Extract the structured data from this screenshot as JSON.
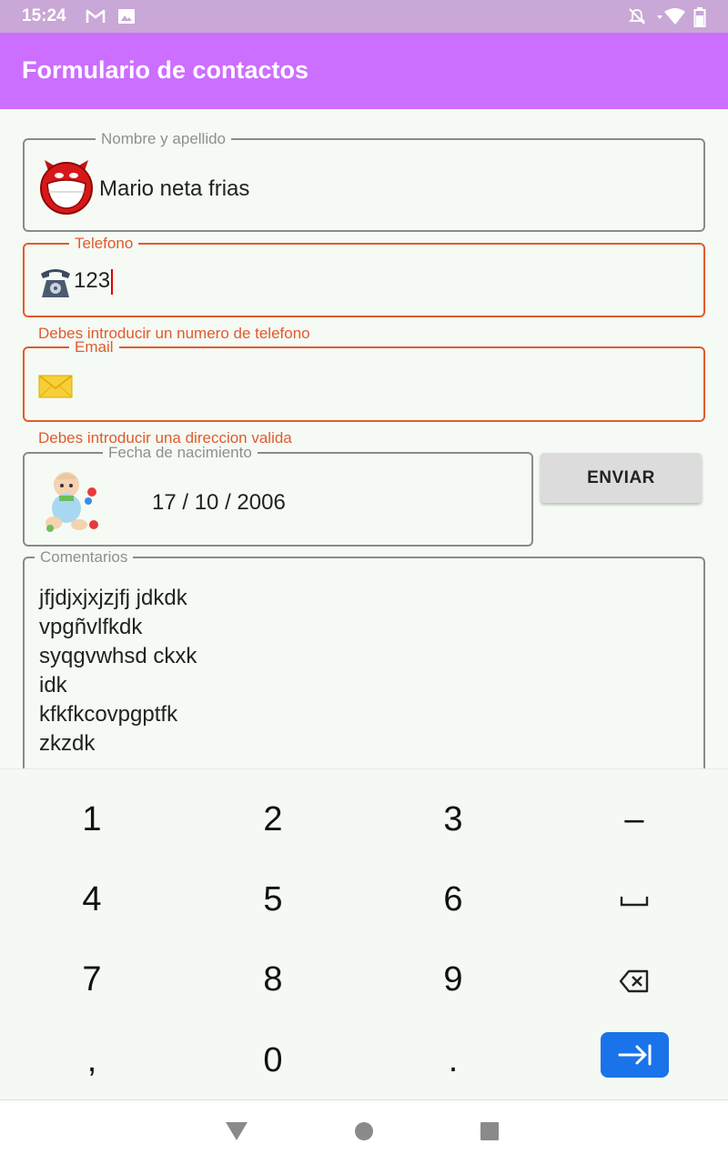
{
  "status_bar": {
    "time": "15:24",
    "icons": [
      "gmail-icon",
      "image-icon",
      "mute-icon",
      "wifi-icon",
      "battery-icon"
    ]
  },
  "app_bar": {
    "title": "Formulario de contactos"
  },
  "form": {
    "name": {
      "label": "Nombre y apellido",
      "value": "Mario neta frias",
      "icon": "devil-face-icon"
    },
    "phone": {
      "label": "Telefono",
      "value": "123",
      "icon": "telephone-icon",
      "error": "Debes introducir un numero de telefono"
    },
    "email": {
      "label": "Email",
      "value": "",
      "icon": "envelope-icon",
      "error": "Debes introducir una direccion valida"
    },
    "birthdate": {
      "label": "Fecha de nacimiento",
      "value": "17 / 10 / 2006",
      "icon": "baby-icon"
    },
    "send_button": "ENVIAR",
    "comments": {
      "label": "Comentarios",
      "lines": [
        "jfjdjxjxjzjfj jdkdk",
        "vpgñvlfkdk",
        "syqgvwhsd ckxk",
        "idk",
        "kfkfkcovpgptfk",
        "zkzdk"
      ]
    }
  },
  "keyboard": {
    "keys": [
      "1",
      "2",
      "3",
      "–",
      "4",
      "5",
      "6",
      "space",
      "7",
      "8",
      "9",
      "backspace",
      ",",
      "0",
      ".",
      "next"
    ],
    "accent_color": "#1a73e8"
  },
  "nav_bar": {
    "buttons": [
      "back",
      "home",
      "recents"
    ]
  },
  "colors": {
    "app_bar": "#cc6eff",
    "status_bar": "#c9a7d6",
    "error": "#e25a2c"
  }
}
